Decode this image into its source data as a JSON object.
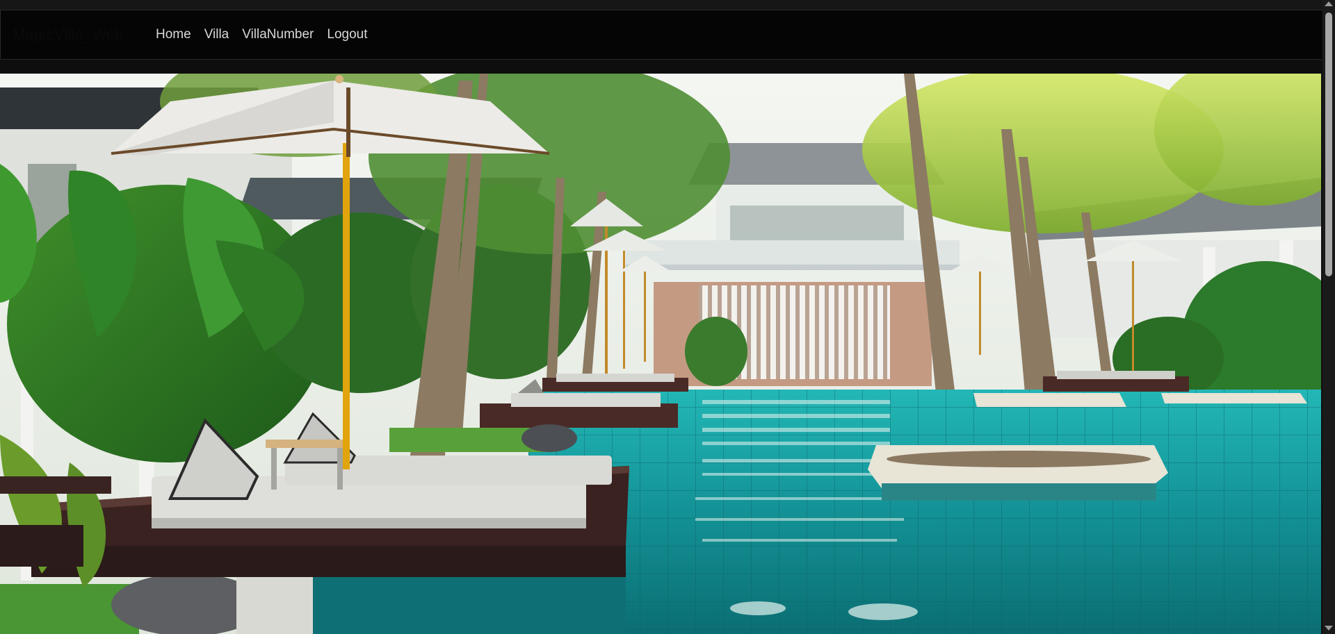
{
  "navbar": {
    "brand": "MagicVilla_Web",
    "links": [
      {
        "label": "Home"
      },
      {
        "label": "Villa"
      },
      {
        "label": "VillaNumber"
      },
      {
        "label": "Logout"
      }
    ]
  },
  "hero": {
    "image": "resort-pool-villa-photo"
  },
  "colors": {
    "navbar_bg": "#050505",
    "nav_text": "#d8d8d8",
    "pool": "#1aa3a6"
  }
}
